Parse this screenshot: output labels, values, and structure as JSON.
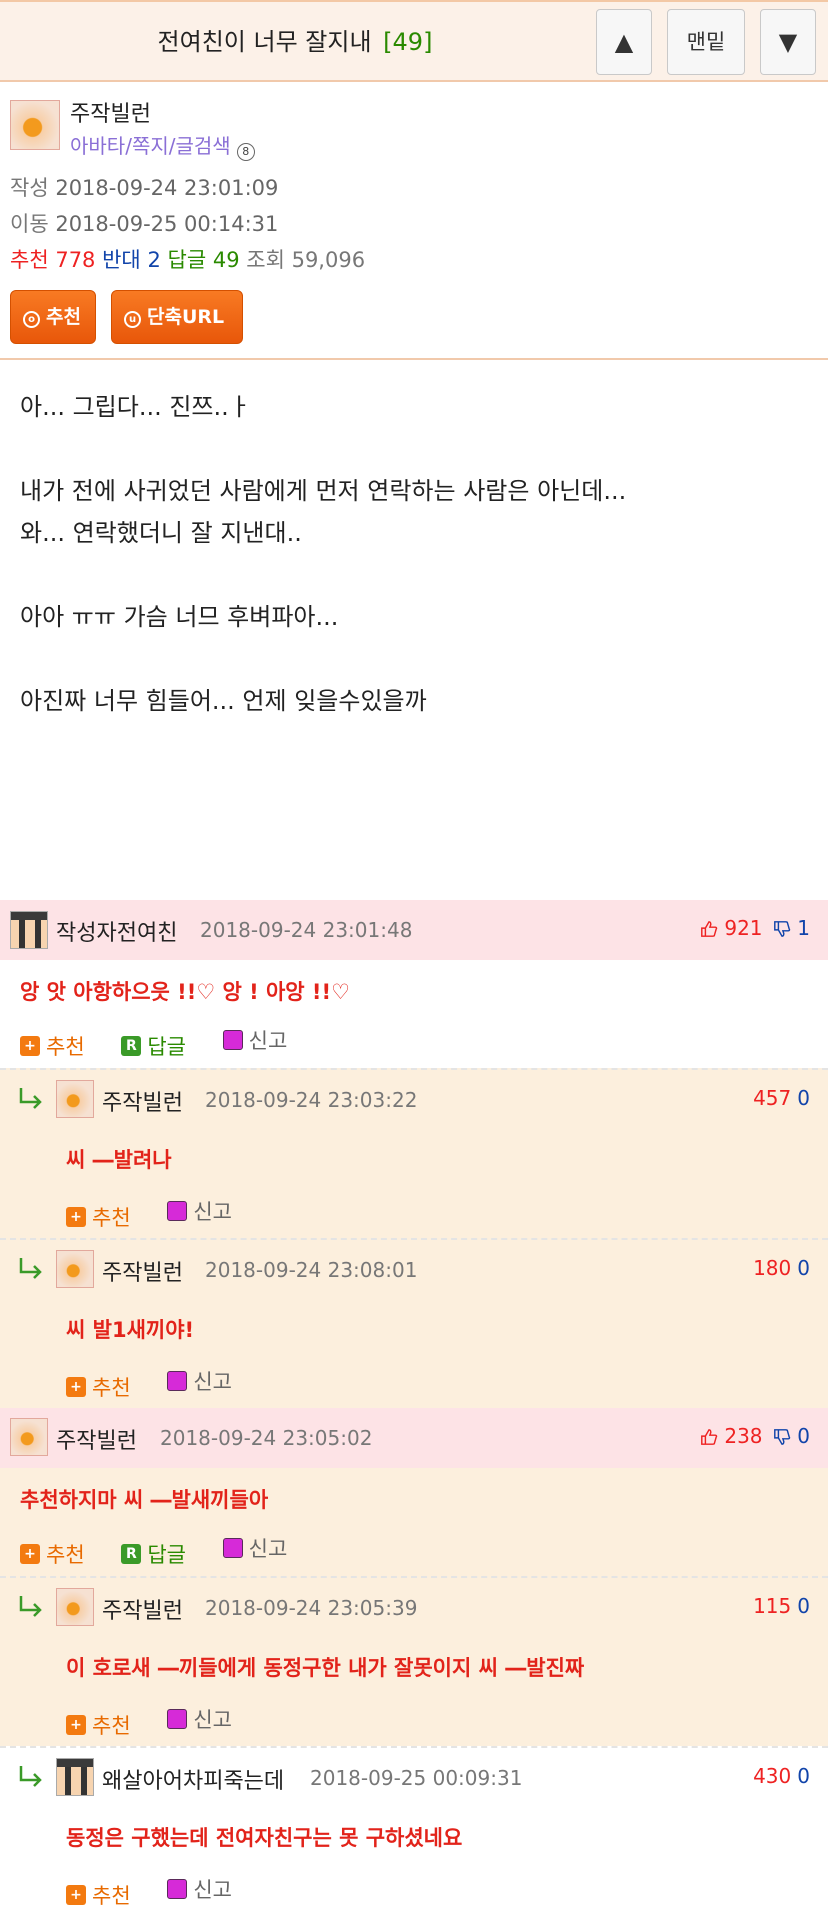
{
  "header": {
    "title": "전여친이 너무 잘지내",
    "comment_count": "[49]",
    "up_btn": "▲",
    "bottom_btn": "맨밑",
    "down_btn": "▼"
  },
  "post": {
    "author": "주작빌런",
    "author_links": "아바타/쪽지/글검색",
    "written_label": "작성",
    "written": "2018-09-24 23:01:09",
    "moved_label": "이동",
    "moved": "2018-09-25 00:14:31",
    "stats": {
      "recommend_label": "추천",
      "recommend": "778",
      "oppose_label": "반대",
      "oppose": "2",
      "replies_label": "답글",
      "replies": "49",
      "views_label": "조회",
      "views": "59,096"
    },
    "buttons": {
      "recommend": "추천",
      "short_url": "단축URL"
    },
    "body": [
      "아... 그립다... 진쯔..ㅏ",
      "",
      "내가 전에 사귀었던 사람에게 먼저 연락하는 사람은 아닌데...",
      "와... 연락했더니 잘 지낸대..",
      "",
      "아아 ㅠㅠ 가슴 너므 후벼파아...",
      "",
      "아진짜 너무 힘들어... 언제 잊을수있을까"
    ]
  },
  "actions": {
    "recommend": "추천",
    "reply": "답글",
    "report": "신고"
  },
  "comments": [
    {
      "name": "작성자전여친",
      "date": "2018-09-24 23:01:48",
      "up": "921",
      "down": "1",
      "text": "앙 앗 아항하으읏 !!♡ 앙 ! 아앙 !!♡"
    },
    {
      "name": "주작빌런",
      "date": "2018-09-24 23:03:22",
      "up": "457",
      "down": "0",
      "text": "씨 ―발려나"
    },
    {
      "name": "주작빌런",
      "date": "2018-09-24 23:08:01",
      "up": "180",
      "down": "0",
      "text": "씨 발1새끼야!"
    },
    {
      "name": "주작빌런",
      "date": "2018-09-24 23:05:02",
      "up": "238",
      "down": "0",
      "text": "추천하지마 씨 ―발새끼들아"
    },
    {
      "name": "주작빌런",
      "date": "2018-09-24 23:05:39",
      "up": "115",
      "down": "0",
      "text": "이 호로새 ―끼들에게 동정구한 내가 잘못이지 씨 ―발진짜"
    },
    {
      "name": "왜살아어차피죽는데",
      "date": "2018-09-25 00:09:31",
      "up": "430",
      "down": "0",
      "text": "동정은 구했는데 전여자친구는 못 구하셨네요"
    }
  ],
  "colors": {
    "accent_orange": "#e8570a",
    "header_bg": "#fcf1e8",
    "best_comment_bg": "#fde3e6",
    "reply_bg": "#fcefdd",
    "comment_text": "#e2231a"
  }
}
